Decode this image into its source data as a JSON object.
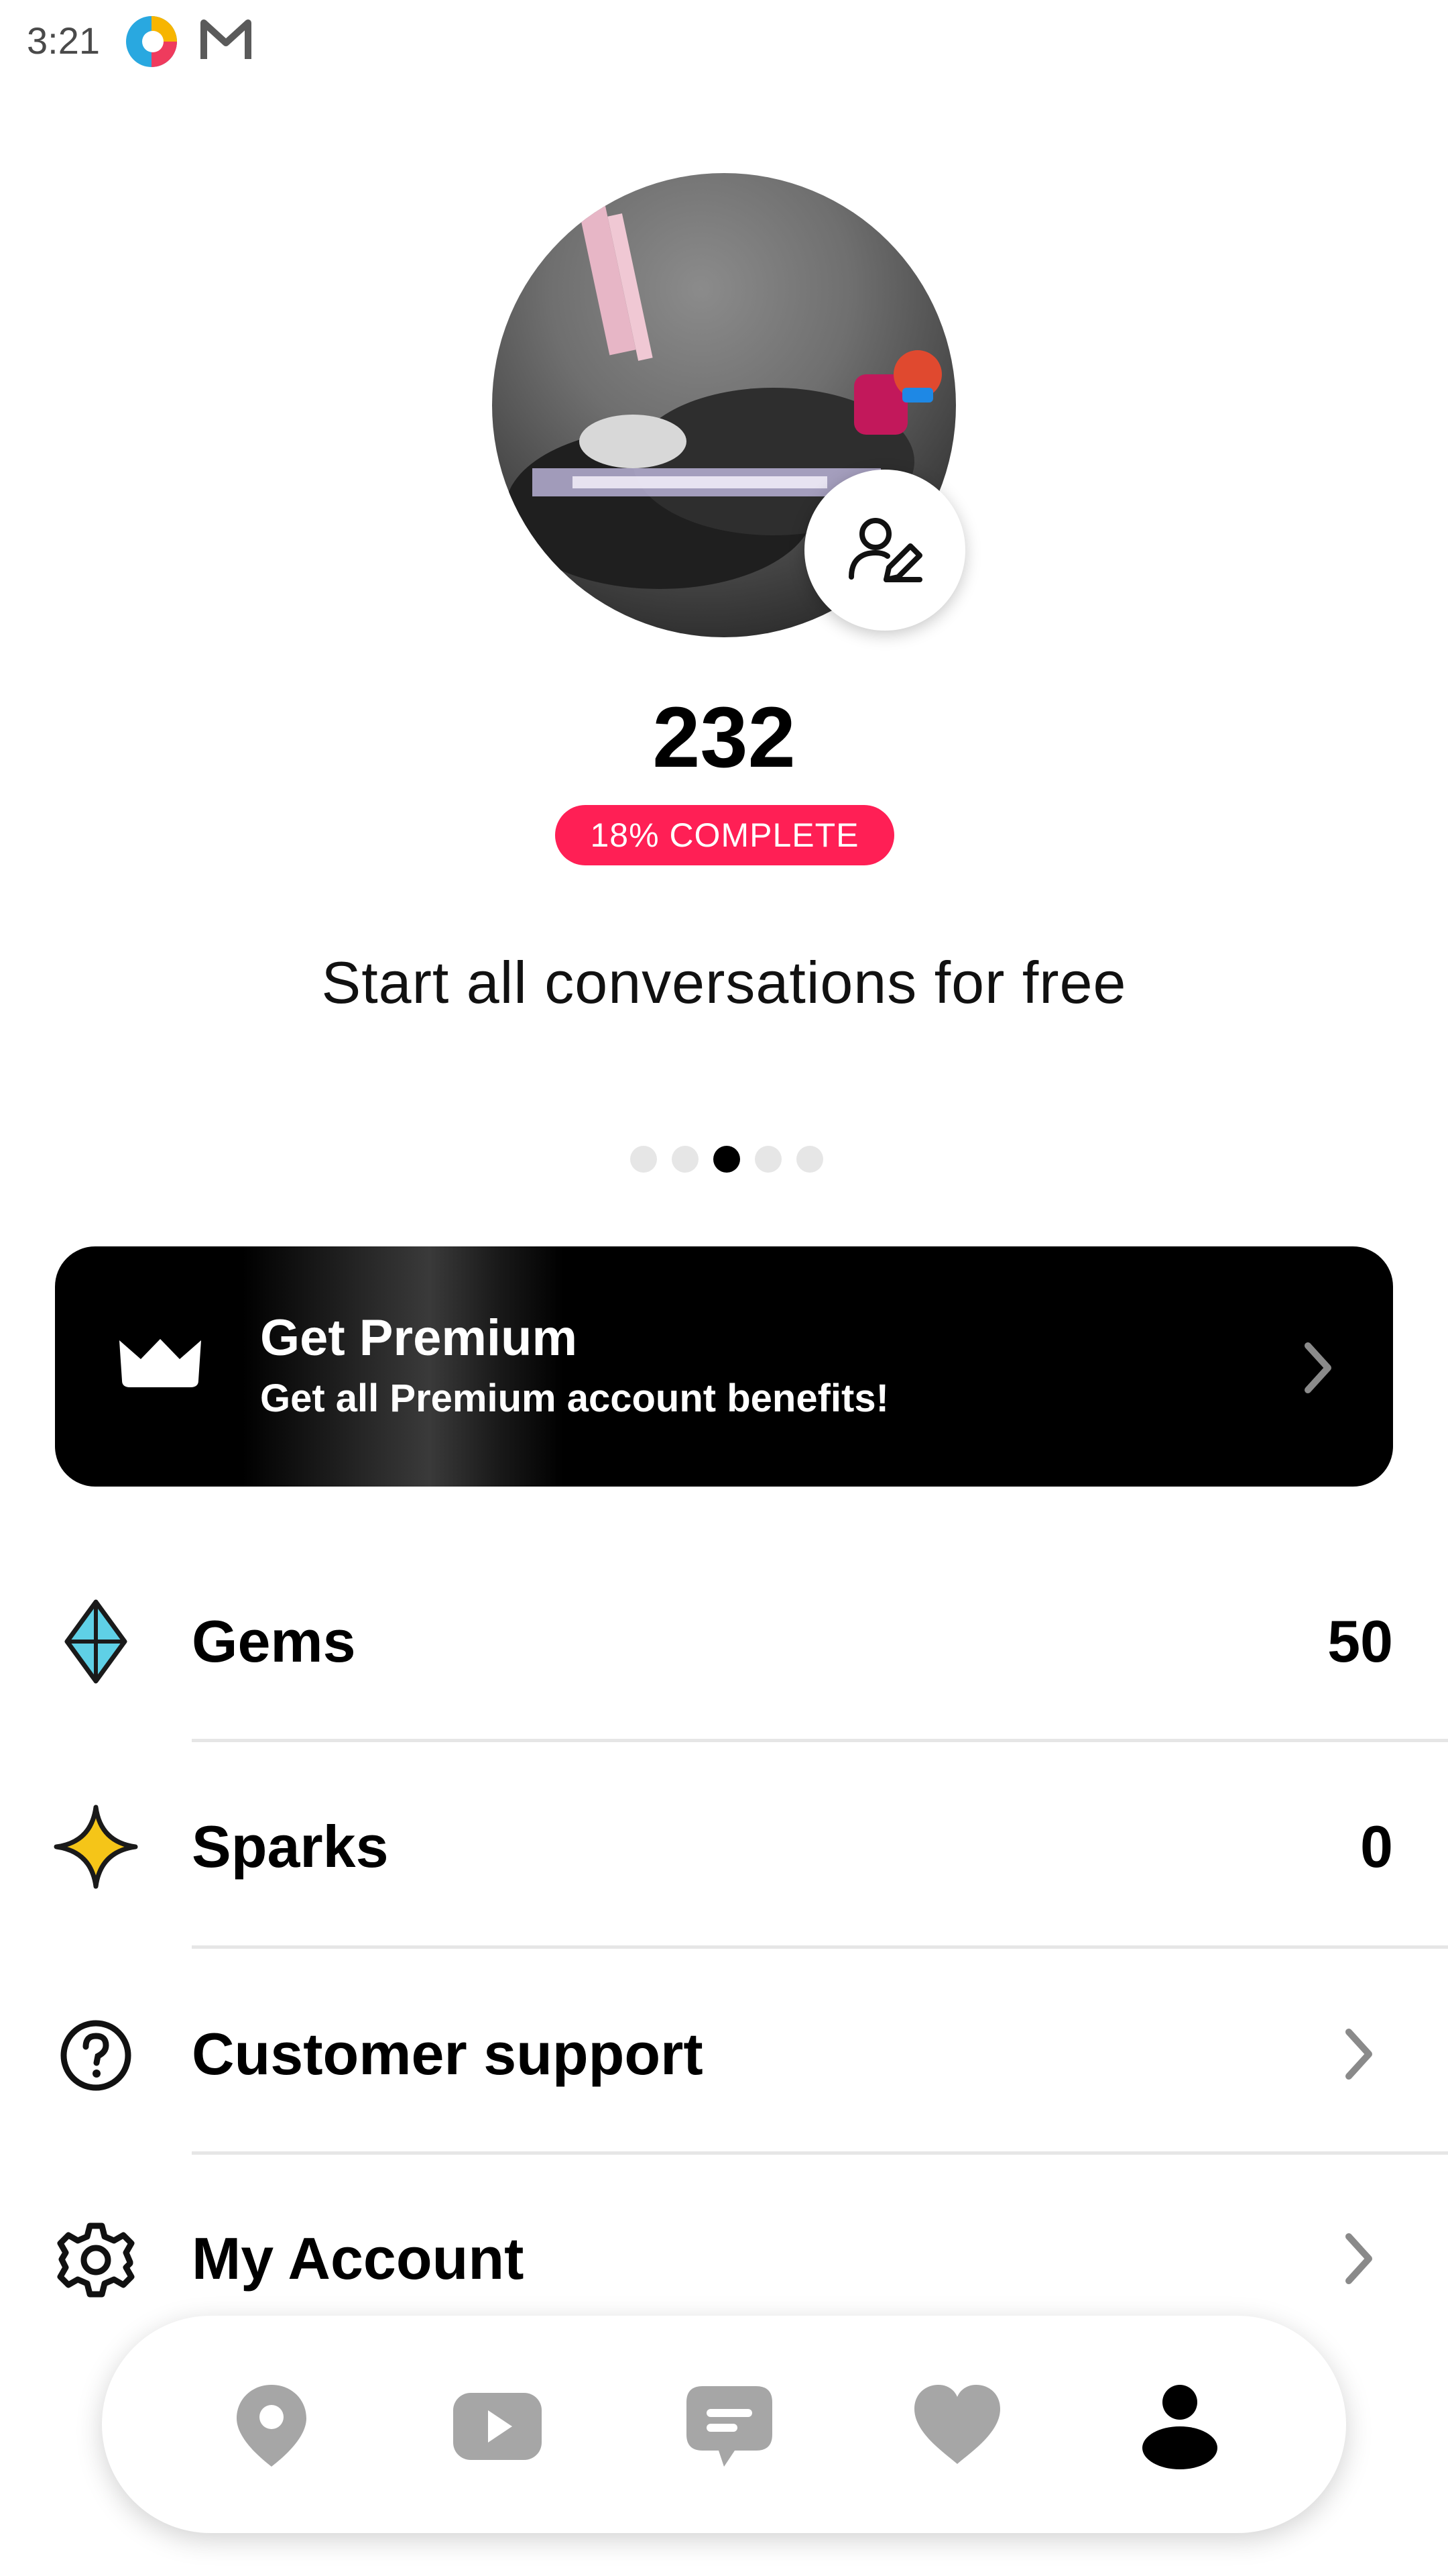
{
  "status_bar": {
    "time": "3:21"
  },
  "profile": {
    "age": "232",
    "completion_badge": "18% COMPLETE",
    "completion_percent": 18,
    "promo_text": "Start all conversations for free",
    "carousel": {
      "count": 5,
      "active_index": 2
    }
  },
  "premium": {
    "title": "Get Premium",
    "subtitle": "Get all Premium account benefits!"
  },
  "menu": [
    {
      "label": "Gems",
      "value": "50",
      "icon": "diamond-icon"
    },
    {
      "label": "Sparks",
      "value": "0",
      "icon": "sparkle-icon"
    },
    {
      "label": "Customer support",
      "icon": "help-icon"
    },
    {
      "label": "My Account",
      "icon": "gear-icon"
    }
  ],
  "bottom_nav": [
    {
      "name": "location",
      "icon": "location-pin-icon",
      "active": false
    },
    {
      "name": "videos",
      "icon": "play-icon",
      "active": false
    },
    {
      "name": "messages",
      "icon": "chat-icon",
      "active": false
    },
    {
      "name": "likes",
      "icon": "heart-icon",
      "active": false
    },
    {
      "name": "profile",
      "icon": "person-icon",
      "active": true
    }
  ],
  "colors": {
    "accent": "#ff1f55",
    "gem": "#5fd0e6",
    "spark": "#f5c518",
    "nav_inactive": "#a6a6a6",
    "nav_active": "#000000"
  }
}
